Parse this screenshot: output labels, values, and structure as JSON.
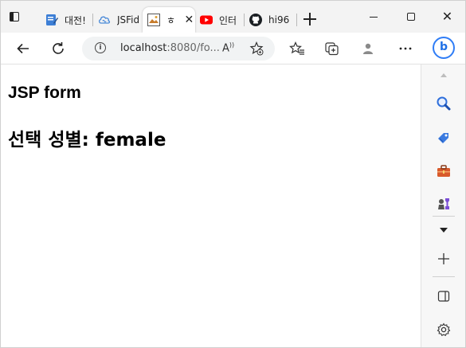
{
  "browser": {
    "tabs": [
      {
        "label": "대전!",
        "icon": "notepad-icon"
      },
      {
        "label": "JSFid",
        "icon": "cloud-icon"
      },
      {
        "label": "ㅎ",
        "icon": "image-icon",
        "active": true
      },
      {
        "label": "인터",
        "icon": "youtube-icon"
      },
      {
        "label": "hi96",
        "icon": "github-icon"
      }
    ],
    "address": {
      "host": "localhost",
      "rest": ":8080/fo..."
    },
    "read_aloud": "A",
    "colors": {
      "accent": "#2f7df6",
      "youtube": "#ff0000"
    }
  },
  "page": {
    "heading": "JSP form",
    "result": "선택 성별: female"
  }
}
